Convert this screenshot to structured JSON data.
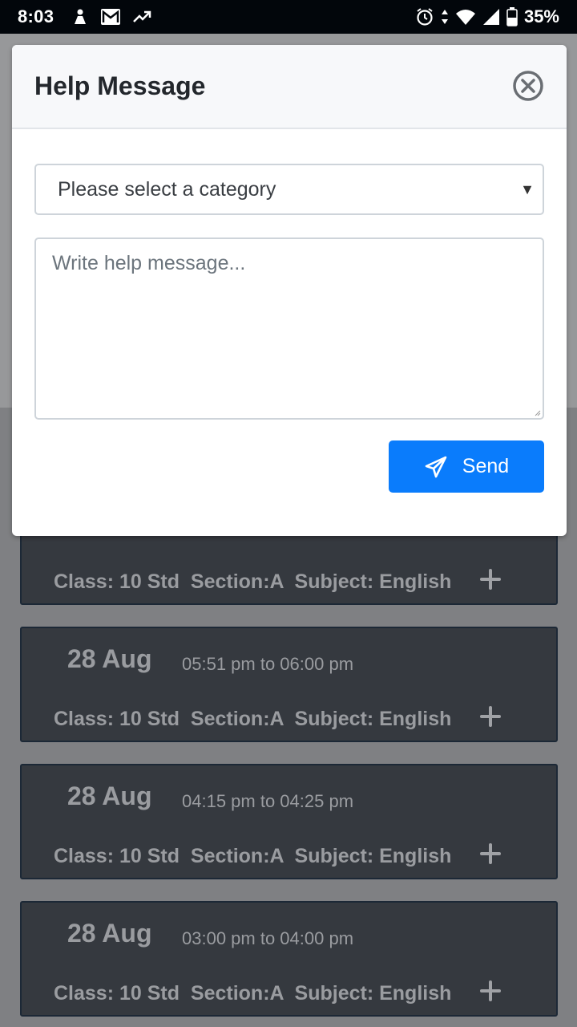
{
  "status_bar": {
    "time": "8:03",
    "battery": "35%"
  },
  "modal": {
    "title": "Help Message",
    "category_select": {
      "selected": "Please select a category"
    },
    "message_field": {
      "placeholder": "Write help message..."
    },
    "send_label": "Send",
    "accent_color": "#0a7cfc"
  },
  "schedule": [
    {
      "date": "",
      "time": "",
      "info": "Class: 10 Std  Section:A  Subject: English"
    },
    {
      "date": "28 Aug",
      "time": "05:51 pm to 06:00 pm",
      "info": "Class: 10 Std  Section:A  Subject: English"
    },
    {
      "date": "28 Aug",
      "time": "04:15 pm to 04:25 pm",
      "info": "Class: 10 Std  Section:A  Subject: English"
    },
    {
      "date": "28 Aug",
      "time": "03:00 pm to 04:00 pm",
      "info": "Class: 10 Std  Section:A  Subject: English"
    }
  ]
}
